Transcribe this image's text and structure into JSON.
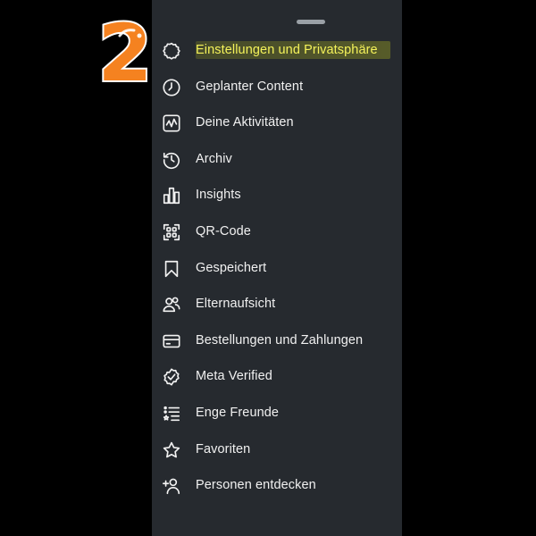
{
  "step_badge": {
    "number": "2",
    "color": "#f58220"
  },
  "menu": {
    "items": [
      {
        "label": "Einstellungen und Privatsphäre",
        "icon": "settings-icon",
        "highlighted": true
      },
      {
        "label": "Geplanter Content",
        "icon": "clock-icon"
      },
      {
        "label": "Deine Aktivitäten",
        "icon": "activity-icon"
      },
      {
        "label": "Archiv",
        "icon": "archive-icon"
      },
      {
        "label": "Insights",
        "icon": "insights-icon"
      },
      {
        "label": "QR-Code",
        "icon": "qr-code-icon"
      },
      {
        "label": "Gespeichert",
        "icon": "bookmark-icon"
      },
      {
        "label": "Elternaufsicht",
        "icon": "supervision-icon"
      },
      {
        "label": "Bestellungen und Zahlungen",
        "icon": "card-icon"
      },
      {
        "label": "Meta Verified",
        "icon": "verified-icon"
      },
      {
        "label": "Enge Freunde",
        "icon": "close-friends-icon"
      },
      {
        "label": "Favoriten",
        "icon": "star-icon"
      },
      {
        "label": "Personen entdecken",
        "icon": "add-person-icon"
      }
    ]
  },
  "colors": {
    "panel": "#262a2f",
    "highlight_text": "#f4f25a",
    "background": "#000000"
  }
}
